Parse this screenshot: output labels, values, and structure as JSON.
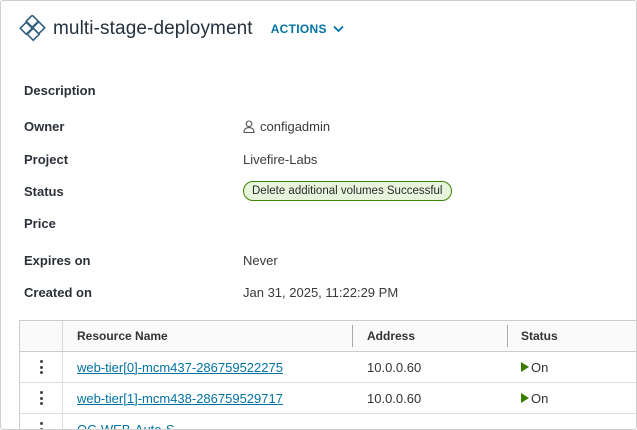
{
  "header": {
    "title": "multi-stage-deployment",
    "actions_label": "ACTIONS",
    "logo_icon": "deployment-diamonds-icon",
    "accent_color": "#0072a3"
  },
  "details": {
    "description": {
      "label": "Description",
      "value": ""
    },
    "owner": {
      "label": "Owner",
      "value": "configadmin",
      "icon": "user-icon"
    },
    "project": {
      "label": "Project",
      "value": "Livefire-Labs"
    },
    "status": {
      "label": "Status",
      "value": "Delete additional volumes Successful",
      "color": "#3c8500"
    },
    "price": {
      "label": "Price",
      "value": ""
    },
    "expires_on": {
      "label": "Expires on",
      "value": "Never"
    },
    "created_on": {
      "label": "Created on",
      "value": "Jan 31, 2025, 11:22:29 PM"
    }
  },
  "resources": {
    "columns": [
      "Resource Name",
      "Address",
      "Status"
    ],
    "rows": [
      {
        "name": "web-tier[0]-mcm437-286759522275",
        "address": "10.0.0.60",
        "status": "On"
      },
      {
        "name": "web-tier[1]-mcm438-286759529717",
        "address": "10.0.0.60",
        "status": "On"
      },
      {
        "name": "OC-WEB-Auto-S",
        "address": "",
        "status": ""
      }
    ],
    "status_on_color": "#3a7d00"
  }
}
